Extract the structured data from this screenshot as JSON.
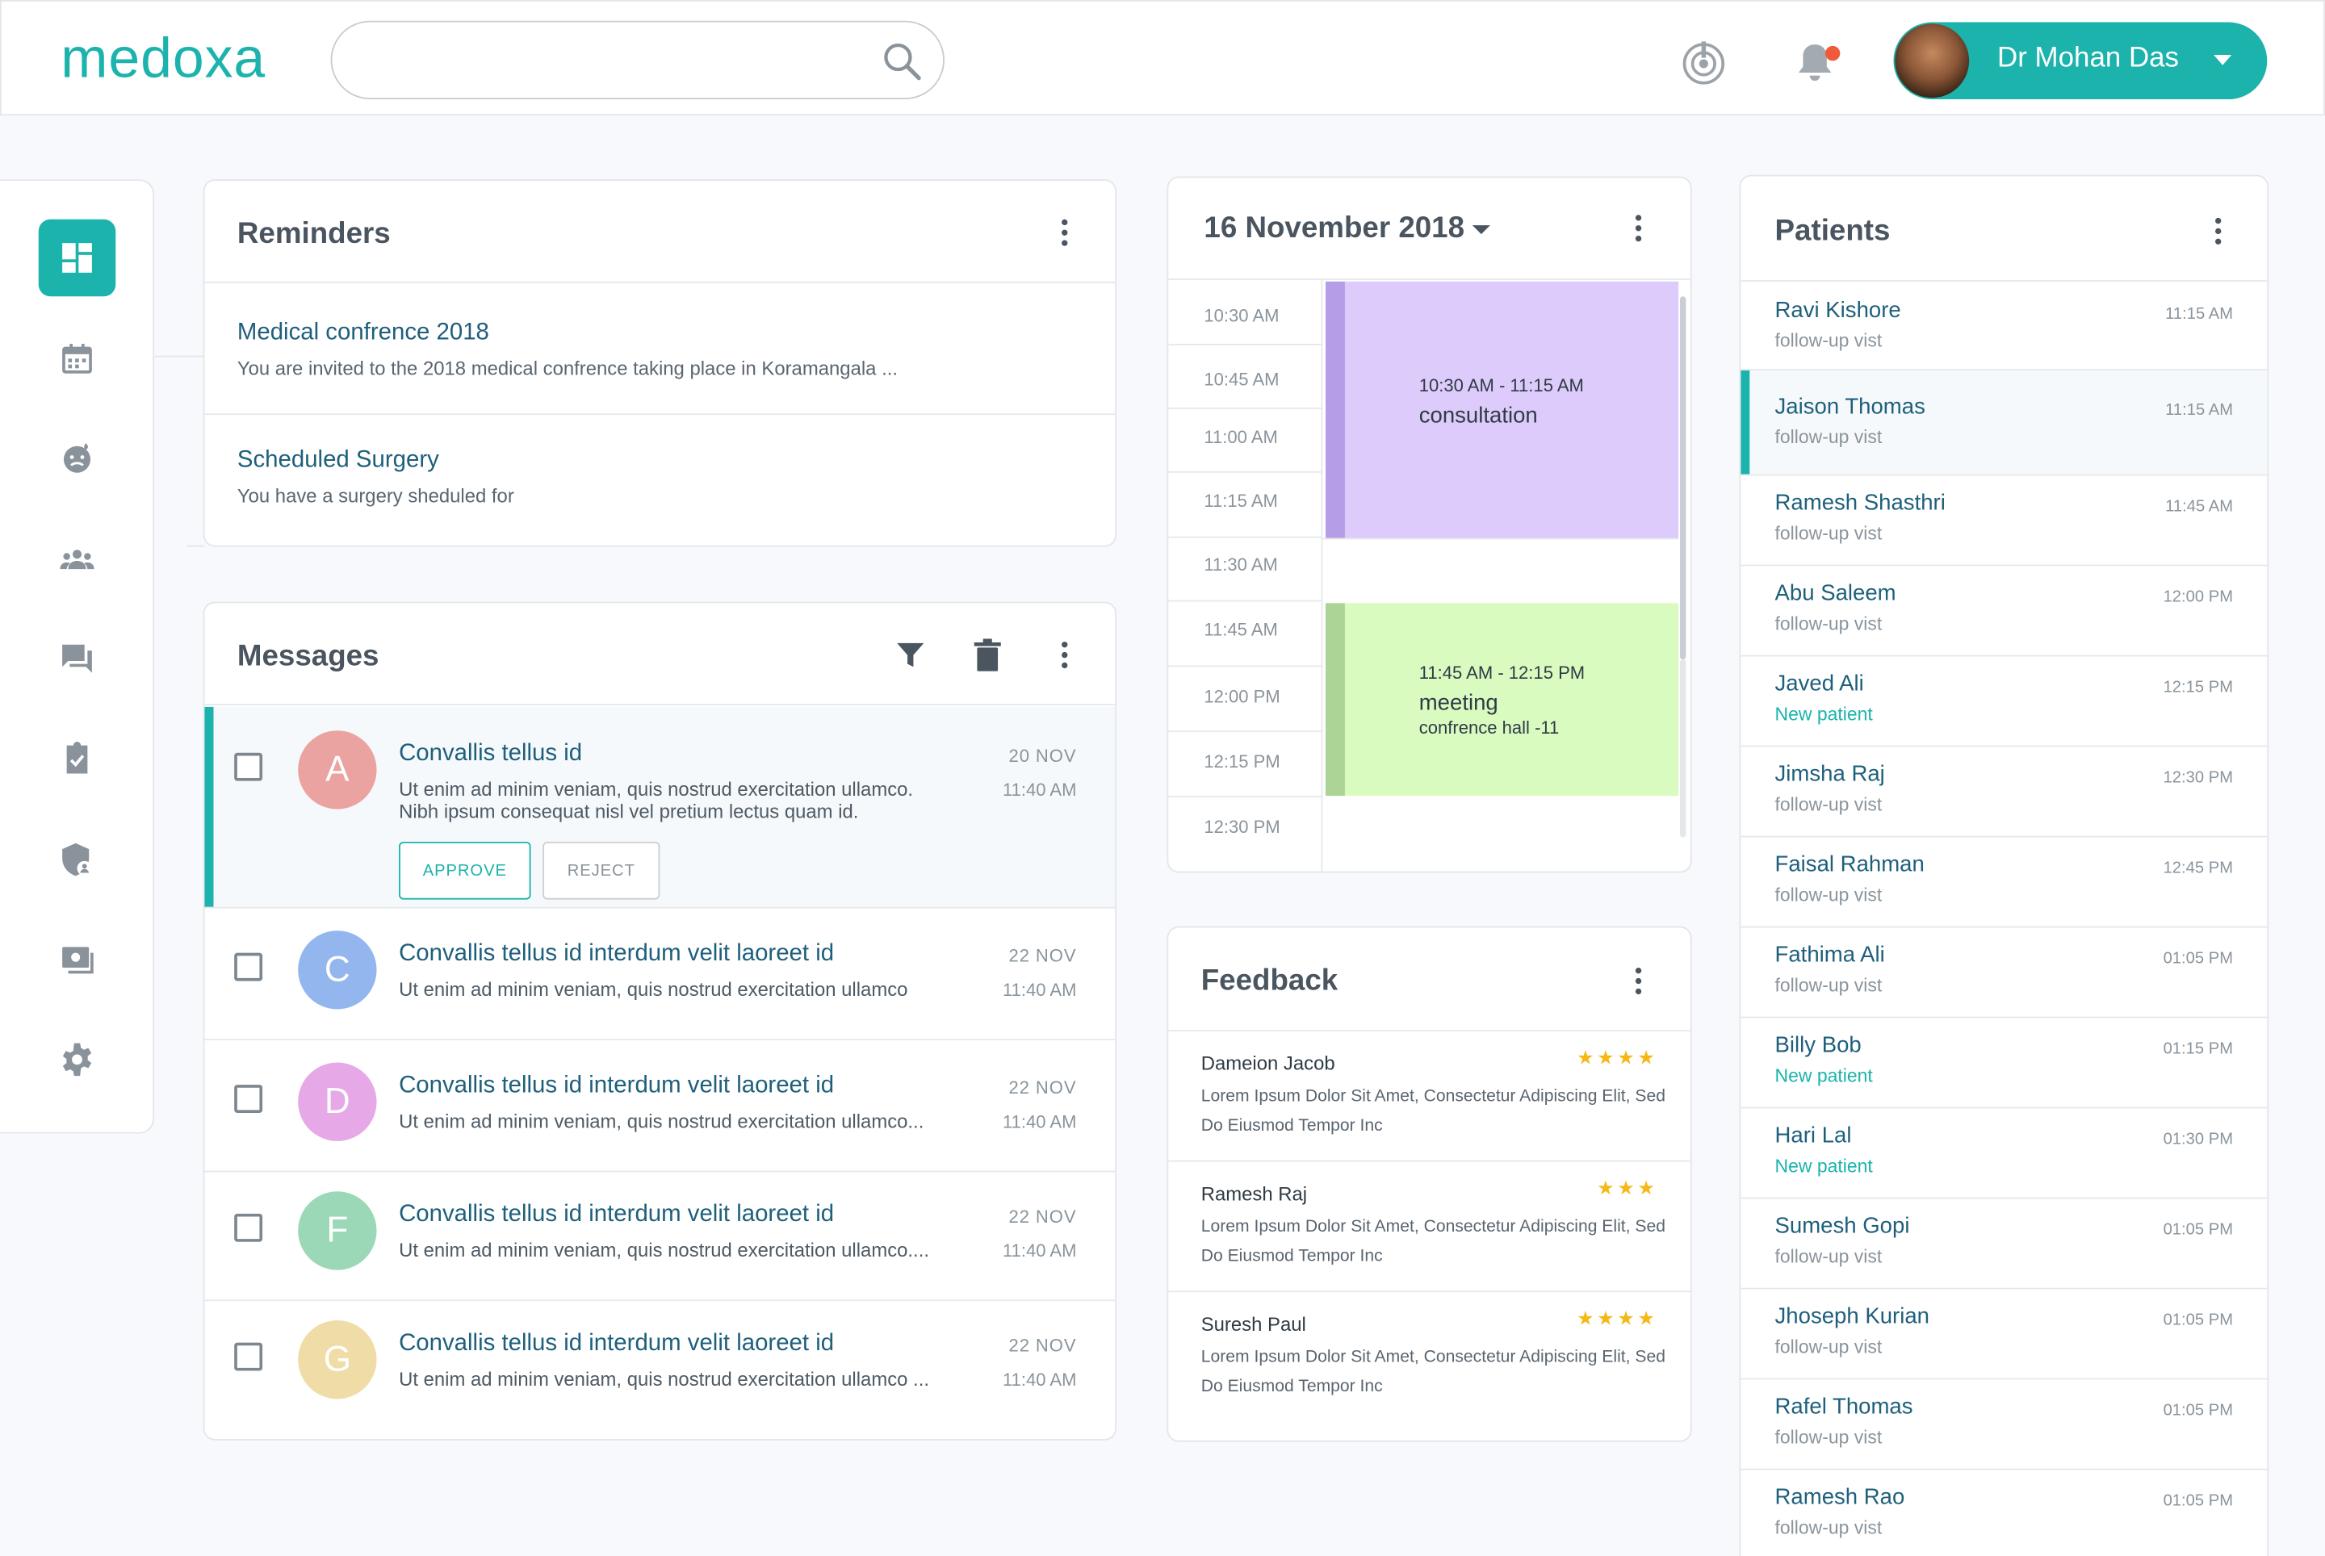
{
  "header": {
    "logo": "medoxa",
    "search_placeholder": "",
    "user_name": "Dr Mohan Das"
  },
  "colors": {
    "accent": "#1bb3ac",
    "title_text": "#1e5f7c",
    "notification_dot": "#ef5a3c",
    "star": "#f6b817"
  },
  "sidebar": {
    "items": [
      {
        "icon": "dashboard-icon",
        "active": true
      },
      {
        "icon": "calendar-icon",
        "active": false
      },
      {
        "icon": "patient-emoji-icon",
        "active": false
      },
      {
        "icon": "group-icon",
        "active": false
      },
      {
        "icon": "chat-icon",
        "active": false
      },
      {
        "icon": "clipboard-check-icon",
        "active": false
      },
      {
        "icon": "shield-user-icon",
        "active": false
      },
      {
        "icon": "video-screen-icon",
        "active": false
      },
      {
        "icon": "settings-icon",
        "active": false
      }
    ]
  },
  "reminders": {
    "title": "Reminders",
    "items": [
      {
        "title": "Medical confrence 2018",
        "body": "You are invited to the 2018 medical confrence taking place in Koramangala ..."
      },
      {
        "title": "Scheduled Surgery",
        "body": "You have a surgery sheduled for"
      }
    ]
  },
  "messages": {
    "title": "Messages",
    "approve_label": "APPROVE",
    "reject_label": "REJECT",
    "items": [
      {
        "initial": "A",
        "avatar_color": "#eaa3a1",
        "title": "Convallis tellus id",
        "body1": "Ut enim ad minim veniam, quis nostrud exercitation ullamco.",
        "body2": "Nibh ipsum consequat nisl vel pretium lectus quam id.",
        "date": "20  NOV",
        "time": "11:40 AM"
      },
      {
        "initial": "C",
        "avatar_color": "#93b6ee",
        "title": "Convallis tellus id interdum velit laoreet id",
        "body1": "Ut enim ad minim veniam, quis nostrud exercitation ullamco",
        "date": "22  NOV",
        "time": "11:40 AM"
      },
      {
        "initial": "D",
        "avatar_color": "#e6a8e6",
        "title": "Convallis tellus id interdum velit laoreet id",
        "body1": "Ut enim ad minim veniam, quis nostrud exercitation ullamco...",
        "date": "22  NOV",
        "time": "11:40 AM"
      },
      {
        "initial": "F",
        "avatar_color": "#9ad8b7",
        "title": "Convallis tellus id interdum velit laoreet id",
        "body1": "Ut enim ad minim veniam, quis nostrud exercitation ullamco....",
        "date": "22  NOV",
        "time": "11:40 AM"
      },
      {
        "initial": "G",
        "avatar_color": "#efdca6",
        "title": "Convallis tellus id interdum velit laoreet id",
        "body1": "Ut enim ad minim veniam, quis nostrud exercitation ullamco ...",
        "date": "22  NOV",
        "time": "11:40 AM"
      }
    ]
  },
  "calendar": {
    "date": "16 November 2018",
    "times": [
      "10:30 AM",
      "10:45 AM",
      "11:00 AM",
      "11:15 AM",
      "11:30 AM",
      "11:45 AM",
      "12:00 PM",
      "12:15 PM",
      "12:30 PM"
    ],
    "events": [
      {
        "time": "10:30 AM - 11:15 AM",
        "name": "consultation",
        "sub": "",
        "color": "#dccbfb",
        "bar": "#b59de8"
      },
      {
        "time": "11:45 AM - 12:15 PM",
        "name": "meeting",
        "sub": "confrence hall -11",
        "color": "#d9fbc0",
        "bar": "#acd497"
      }
    ]
  },
  "feedback": {
    "title": "Feedback",
    "items": [
      {
        "name": "Dameion Jacob",
        "stars": "★★★★",
        "text": "Lorem Ipsum Dolor Sit Amet, Consectetur Adipiscing Elit, Sed Do Eiusmod Tempor Inc"
      },
      {
        "name": "Ramesh Raj",
        "stars": "★★★",
        "text": "Lorem Ipsum Dolor Sit Amet, Consectetur Adipiscing Elit, Sed Do Eiusmod Tempor Inc"
      },
      {
        "name": "Suresh Paul",
        "stars": "★★★★",
        "text": "Lorem Ipsum Dolor Sit Amet, Consectetur Adipiscing Elit, Sed Do Eiusmod Tempor Inc"
      }
    ]
  },
  "patients": {
    "title": "Patients",
    "items": [
      {
        "name": "Ravi Kishore",
        "status": "follow-up vist",
        "time": "11:15 AM"
      },
      {
        "name": "Jaison Thomas",
        "status": "follow-up vist",
        "time": "11:15 AM"
      },
      {
        "name": "Ramesh Shasthri",
        "status": "follow-up vist",
        "time": "11:45 AM"
      },
      {
        "name": "Abu Saleem",
        "status": "follow-up vist",
        "time": "12:00 PM"
      },
      {
        "name": "Javed Ali",
        "status": "New patient",
        "time": "12:15 PM"
      },
      {
        "name": "Jimsha Raj",
        "status": "follow-up vist",
        "time": "12:30 PM"
      },
      {
        "name": "Faisal Rahman",
        "status": "follow-up vist",
        "time": "12:45 PM"
      },
      {
        "name": "Fathima Ali",
        "status": "follow-up vist",
        "time": "01:05 PM"
      },
      {
        "name": "Billy Bob",
        "status": "New patient",
        "time": "01:15 PM"
      },
      {
        "name": "Hari Lal",
        "status": "New patient",
        "time": "01:30 PM"
      },
      {
        "name": "Sumesh Gopi",
        "status": "follow-up vist",
        "time": "01:05 PM"
      },
      {
        "name": "Jhoseph Kurian",
        "status": "follow-up vist",
        "time": "01:05 PM"
      },
      {
        "name": "Rafel Thomas",
        "status": "follow-up vist",
        "time": "01:05 PM"
      },
      {
        "name": "Ramesh Rao",
        "status": "follow-up vist",
        "time": "01:05 PM"
      }
    ]
  }
}
